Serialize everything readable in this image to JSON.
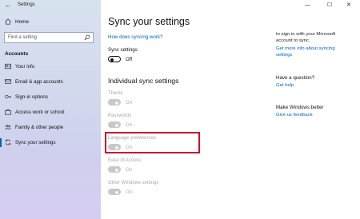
{
  "window": {
    "title": "Settings",
    "controls": {
      "minimize": "—",
      "maximize": "☐",
      "close": "✕"
    }
  },
  "sidebar": {
    "home_label": "Home",
    "search_placeholder": "Find a setting",
    "section_label": "Accounts",
    "items": [
      {
        "label": "Your info",
        "icon": "person-card-icon"
      },
      {
        "label": "Email & app accounts",
        "icon": "mail-icon"
      },
      {
        "label": "Sign-in options",
        "icon": "key-icon"
      },
      {
        "label": "Access work or school",
        "icon": "briefcase-icon"
      },
      {
        "label": "Family & other people",
        "icon": "people-icon"
      },
      {
        "label": "Sync your settings",
        "icon": "sync-icon",
        "active": true
      }
    ]
  },
  "main": {
    "title": "Sync your settings",
    "how_link": "How does syncing work?",
    "sync_settings_label": "Sync settings",
    "sync_settings_state": "Off",
    "individual_heading": "Individual sync settings",
    "settings": [
      {
        "label": "Theme",
        "state": "On"
      },
      {
        "label": "Passwords",
        "state": "On"
      },
      {
        "label": "Language preferences",
        "state": "On",
        "highlighted": true
      },
      {
        "label": "Ease of Access",
        "state": "On"
      },
      {
        "label": "Other Windows settings",
        "state": "On"
      }
    ]
  },
  "right_panel": {
    "info_line1": "to sign in with your Microsoft",
    "info_line2": "account to sync.",
    "info_link_line1": "Get more info about syncing",
    "info_link_line2": "settings",
    "question_heading": "Have a question?",
    "help_link": "Get help",
    "better_heading": "Make Windows better",
    "feedback_link": "Give us feedback"
  },
  "colors": {
    "accent": "#0063b1",
    "highlight_border": "#c8102e"
  }
}
